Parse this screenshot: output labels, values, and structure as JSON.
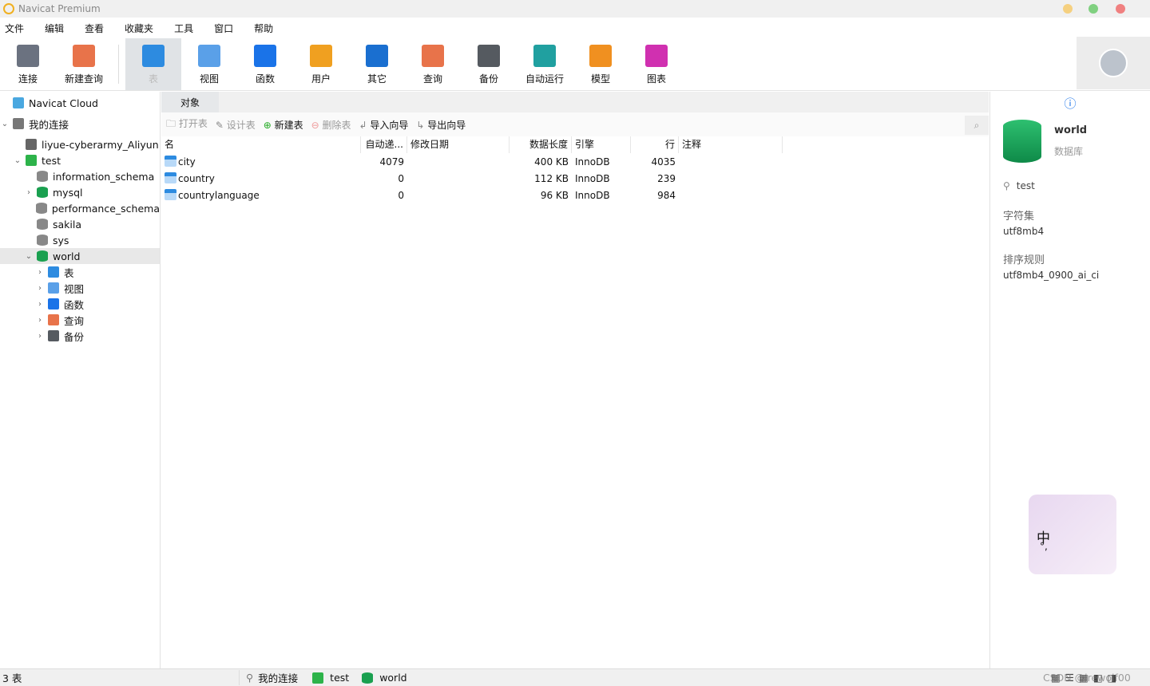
{
  "window": {
    "title": "Navicat Premium"
  },
  "menu": [
    "文件",
    "编辑",
    "查看",
    "收藏夹",
    "工具",
    "窗口",
    "帮助"
  ],
  "toolbar": [
    {
      "label": "连接",
      "icon": "plug-icon",
      "color": "#6b7280"
    },
    {
      "label": "新建查询",
      "icon": "new-query-icon",
      "color": "#e8734a"
    },
    {
      "label": "表",
      "icon": "table-icon",
      "color": "#2d8be0",
      "selected": true
    },
    {
      "label": "视图",
      "icon": "view-icon",
      "color": "#5aa0e8"
    },
    {
      "label": "函数",
      "icon": "function-icon",
      "color": "#1a73e8"
    },
    {
      "label": "用户",
      "icon": "user-icon",
      "color": "#f0a020"
    },
    {
      "label": "其它",
      "icon": "tools-icon",
      "color": "#1a6fd0"
    },
    {
      "label": "查询",
      "icon": "query-icon",
      "color": "#e8734a"
    },
    {
      "label": "备份",
      "icon": "backup-icon",
      "color": "#555a60"
    },
    {
      "label": "自动运行",
      "icon": "robot-icon",
      "color": "#20a0a0"
    },
    {
      "label": "模型",
      "icon": "model-icon",
      "color": "#f09020"
    },
    {
      "label": "图表",
      "icon": "chart-icon",
      "color": "#d030b0"
    }
  ],
  "tree": [
    {
      "label": "Navicat Cloud",
      "level": 0,
      "arrow": "",
      "icon": "cloud-icon",
      "color": "#4aa8e0"
    },
    {
      "label": "我的连接",
      "level": 0,
      "arrow": "⌄",
      "icon": "connection-icon",
      "color": "#777"
    },
    {
      "label": "liyue-cyberarmy_Aliyun",
      "level": 1,
      "arrow": "",
      "icon": "server-icon",
      "color": "#666"
    },
    {
      "label": "test",
      "level": 1,
      "arrow": "⌄",
      "icon": "mysql-connection-icon",
      "color": "#2db34a"
    },
    {
      "label": "information_schema",
      "level": 2,
      "arrow": "",
      "icon": "database-icon",
      "color": "#888"
    },
    {
      "label": "mysql",
      "level": 2,
      "arrow": "›",
      "icon": "database-icon",
      "color": "#1aa050"
    },
    {
      "label": "performance_schema",
      "level": 2,
      "arrow": "",
      "icon": "database-icon",
      "color": "#888"
    },
    {
      "label": "sakila",
      "level": 2,
      "arrow": "",
      "icon": "database-icon",
      "color": "#888"
    },
    {
      "label": "sys",
      "level": 2,
      "arrow": "",
      "icon": "database-icon",
      "color": "#888"
    },
    {
      "label": "world",
      "level": 2,
      "arrow": "⌄",
      "icon": "database-icon",
      "color": "#1aa050",
      "selected": true
    },
    {
      "label": "表",
      "level": 3,
      "arrow": "›",
      "icon": "table-icon",
      "color": "#2d8be0"
    },
    {
      "label": "视图",
      "level": 3,
      "arrow": "›",
      "icon": "view-icon",
      "color": "#5aa0e8"
    },
    {
      "label": "函数",
      "level": 3,
      "arrow": "›",
      "icon": "function-icon",
      "color": "#1a73e8"
    },
    {
      "label": "查询",
      "level": 3,
      "arrow": "›",
      "icon": "query-icon",
      "color": "#e8734a"
    },
    {
      "label": "备份",
      "level": 3,
      "arrow": "›",
      "icon": "backup-icon",
      "color": "#555a60"
    }
  ],
  "tabs": {
    "objects": "对象"
  },
  "actions": [
    {
      "label": "打开表",
      "icon": "folder-icon",
      "disabled": true
    },
    {
      "label": "设计表",
      "icon": "pencil-icon",
      "disabled": true
    },
    {
      "label": "新建表",
      "icon": "plus-circle-icon",
      "disabled": false
    },
    {
      "label": "删除表",
      "icon": "minus-circle-icon",
      "disabled": true
    },
    {
      "label": "导入向导",
      "icon": "import-icon",
      "disabled": false
    },
    {
      "label": "导出向导",
      "icon": "export-icon",
      "disabled": false
    }
  ],
  "table": {
    "columns": [
      "名",
      "自动递...",
      "修改日期",
      "数据长度",
      "引擎",
      "行",
      "注释"
    ],
    "rows": [
      [
        "city",
        "4079",
        "",
        "400 KB",
        "InnoDB",
        "4035",
        ""
      ],
      [
        "country",
        "0",
        "",
        "112 KB",
        "InnoDB",
        "239",
        ""
      ],
      [
        "countrylanguage",
        "0",
        "",
        "96 KB",
        "InnoDB",
        "984",
        ""
      ]
    ]
  },
  "info": {
    "name": "world",
    "type": "数据库",
    "connection": "test",
    "charset_label": "字符集",
    "charset": "utf8mb4",
    "collation_label": "排序规则",
    "collation": "utf8mb4_0900_ai_ci"
  },
  "ime": {
    "label": "中",
    "punct": "°,"
  },
  "status": {
    "count": "3 表",
    "connection_group": "我的连接",
    "connection": "test",
    "database": "world"
  },
  "watermark": "CSDN @irewolf00"
}
